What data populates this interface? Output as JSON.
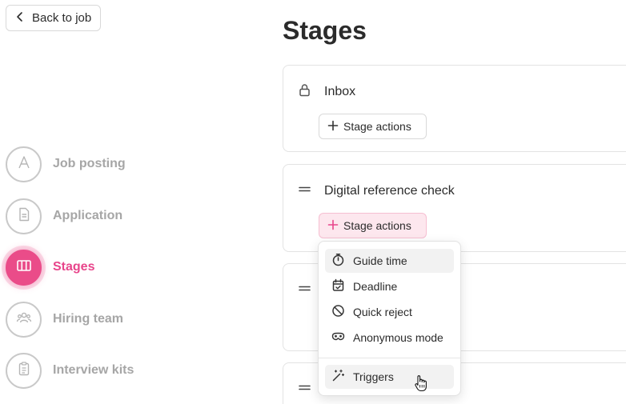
{
  "back_button": {
    "label": "Back to job",
    "icon": "chevron-left-icon"
  },
  "page": {
    "title": "Stages"
  },
  "sidebar": {
    "steps": [
      {
        "label": "Job posting",
        "icon": "letter-a-icon",
        "active": false
      },
      {
        "label": "Application",
        "icon": "document-icon",
        "active": false
      },
      {
        "label": "Stages",
        "icon": "columns-icon",
        "active": true
      },
      {
        "label": "Hiring team",
        "icon": "team-icon",
        "active": false
      },
      {
        "label": "Interview kits",
        "icon": "clipboard-icon",
        "active": false
      }
    ]
  },
  "stages": [
    {
      "name": "Inbox",
      "icon": "lock-icon",
      "actions_label": "Stage actions"
    },
    {
      "name": "Digital reference check",
      "icon": "drag-handle-icon",
      "actions_label": "Stage actions"
    },
    {
      "name": "",
      "icon": "drag-handle-icon"
    },
    {
      "name": "",
      "icon": "drag-handle-icon"
    }
  ],
  "stage_actions_menu": {
    "items": [
      {
        "label": "Guide time",
        "icon": "stopwatch-icon"
      },
      {
        "label": "Deadline",
        "icon": "calendar-check-icon"
      },
      {
        "label": "Quick reject",
        "icon": "block-icon"
      },
      {
        "label": "Anonymous mode",
        "icon": "incognito-mask-icon"
      }
    ],
    "footer_item": {
      "label": "Triggers",
      "icon": "magic-wand-icon"
    }
  },
  "colors": {
    "accent": "#ea4c89",
    "accent_light": "#fde7ee",
    "muted_text": "#a6a6a6"
  }
}
